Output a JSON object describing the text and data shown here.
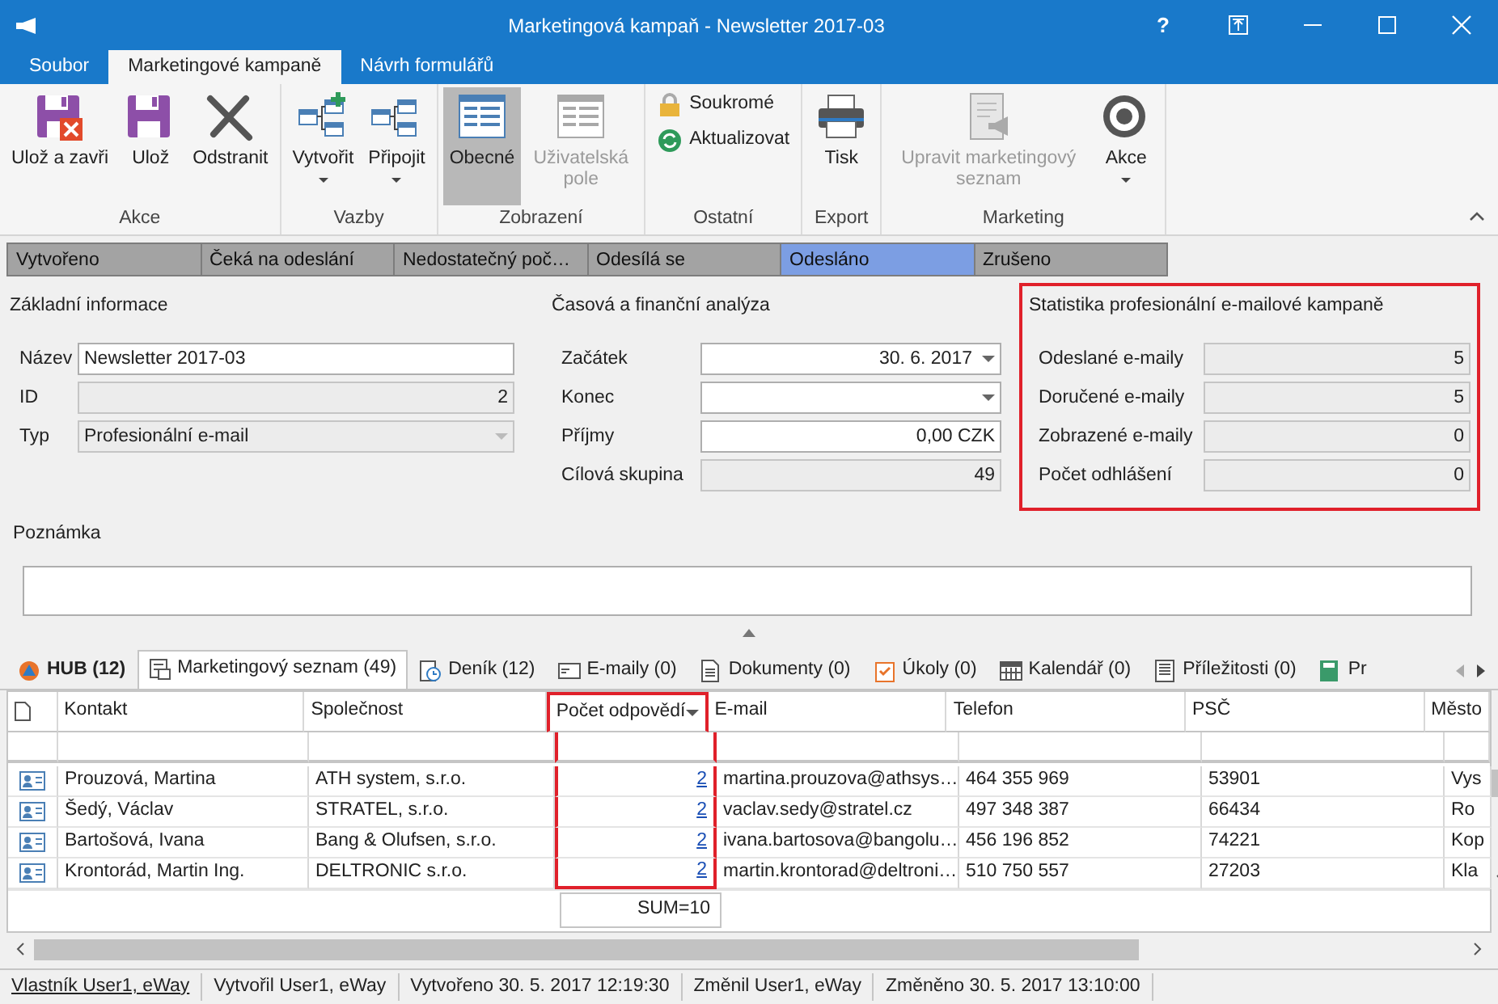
{
  "window": {
    "title": "Marketingová kampaň - Newsletter 2017-03",
    "help": "?"
  },
  "ribbon_tabs": [
    {
      "label": "Soubor",
      "selected": false
    },
    {
      "label": "Marketingové kampaně",
      "selected": true
    },
    {
      "label": "Návrh formulářů",
      "selected": false
    }
  ],
  "ribbon_groups": [
    {
      "label": "Akce",
      "kind": "large",
      "buttons": [
        {
          "label": "Ulož a zavři",
          "disabled": false,
          "selected": false,
          "dropdown": false
        },
        {
          "label": "Ulož",
          "disabled": false,
          "selected": false,
          "dropdown": false
        },
        {
          "label": "Odstranit",
          "disabled": false,
          "selected": false,
          "dropdown": false
        }
      ]
    },
    {
      "label": "Vazby",
      "kind": "large",
      "buttons": [
        {
          "label": "Vytvořit",
          "disabled": false,
          "selected": false,
          "dropdown": true
        },
        {
          "label": "Připojit",
          "disabled": false,
          "selected": false,
          "dropdown": true
        }
      ]
    },
    {
      "label": "Zobrazení",
      "kind": "large",
      "buttons": [
        {
          "label": "Obecné",
          "disabled": false,
          "selected": true,
          "dropdown": false
        },
        {
          "label": "Uživatelská pole",
          "disabled": true,
          "selected": false,
          "dropdown": false
        }
      ]
    },
    {
      "label": "Ostatní",
      "kind": "small",
      "buttons": [
        {
          "label": "Soukromé"
        },
        {
          "label": "Aktualizovat"
        }
      ]
    },
    {
      "label": "Export",
      "kind": "large",
      "buttons": [
        {
          "label": "Tisk",
          "disabled": false,
          "selected": false,
          "dropdown": false
        }
      ]
    },
    {
      "label": "Marketing",
      "kind": "large",
      "buttons": [
        {
          "label": "Upravit marketingový seznam",
          "disabled": true,
          "selected": false,
          "dropdown": false
        },
        {
          "label": "Akce",
          "disabled": false,
          "selected": false,
          "dropdown": true
        }
      ]
    }
  ],
  "stages": [
    {
      "label": "Vytvořeno",
      "selected": false
    },
    {
      "label": "Čeká na odeslání",
      "selected": false
    },
    {
      "label": "Nedostatečný poč…",
      "selected": false
    },
    {
      "label": "Odesílá se",
      "selected": false
    },
    {
      "label": "Odesláno",
      "selected": true
    },
    {
      "label": "Zrušeno",
      "selected": false
    }
  ],
  "sections": [
    {
      "title": "Základní informace",
      "highlighted": false,
      "fields": [
        {
          "label": "Název",
          "value": "Newsletter 2017-03",
          "kind": "text"
        },
        {
          "label": "ID",
          "value": "2",
          "kind": "readonly"
        },
        {
          "label": "Typ",
          "value": "Profesionální e-mail",
          "kind": "readonly-combo"
        }
      ]
    },
    {
      "title": "Časová a finanční analýza",
      "highlighted": false,
      "fields": [
        {
          "label": "Začátek",
          "value": "30. 6. 2017",
          "kind": "combo"
        },
        {
          "label": "Konec",
          "kind": "combo"
        },
        {
          "label": "Příjmy",
          "value": "0,00 CZK",
          "kind": "text"
        },
        {
          "label": "Cílová skupina",
          "value": "49",
          "kind": "readonly"
        }
      ]
    },
    {
      "title": "Statistika profesionální e-mailové kampaně",
      "highlighted": true,
      "fields": [
        {
          "label": "Odeslané e-maily",
          "value": "5",
          "kind": "readonly"
        },
        {
          "label": "Doručené e-maily",
          "value": "5",
          "kind": "readonly"
        },
        {
          "label": "Zobrazené e-maily",
          "value": "0",
          "kind": "readonly"
        },
        {
          "label": "Počet odhlášení",
          "value": "0",
          "kind": "readonly"
        }
      ]
    }
  ],
  "note": {
    "label": "Poznámka"
  },
  "bottom_tabs": [
    {
      "label": "HUB (12)",
      "selected": false,
      "kind": "hub"
    },
    {
      "label": "Marketingový seznam (49)",
      "selected": true,
      "kind": "list"
    },
    {
      "label": "Deník (12)",
      "selected": false,
      "kind": "journal"
    },
    {
      "label": "E-maily (0)",
      "selected": false,
      "kind": "email"
    },
    {
      "label": "Dokumenty (0)",
      "selected": false,
      "kind": "document"
    },
    {
      "label": "Úkoly (0)",
      "selected": false,
      "kind": "task"
    },
    {
      "label": "Kalendář (0)",
      "selected": false,
      "kind": "calendar"
    },
    {
      "label": "Příležitosti (0)",
      "selected": false,
      "kind": "opportunity"
    },
    {
      "label": "Pr",
      "selected": false,
      "kind": "book"
    }
  ],
  "grid": {
    "columns": [
      {
        "label": "Kontakt",
        "kind": "text",
        "highlighted": false,
        "filter_button": false
      },
      {
        "label": "Společnost",
        "kind": "text",
        "highlighted": false,
        "filter_button": false
      },
      {
        "label": "Počet odpovědí",
        "kind": "link",
        "highlighted": true,
        "filter_button": true
      },
      {
        "label": "E-mail",
        "kind": "text",
        "highlighted": false,
        "filter_button": false
      },
      {
        "label": "Telefon",
        "kind": "text",
        "highlighted": false,
        "filter_button": false
      },
      {
        "label": "PSČ",
        "kind": "text",
        "highlighted": false,
        "filter_button": false
      },
      {
        "label": "Město",
        "kind": "text",
        "highlighted": false,
        "filter_button": false
      }
    ],
    "rows": [
      [
        "Prouzová, Martina",
        "ATH system, s.r.o.",
        "2",
        "martina.prouzova@athsys…",
        "464 355 969",
        "53901",
        "Vys"
      ],
      [
        "Šedý, Václav",
        "STRATEL, s.r.o.",
        "2",
        "vaclav.sedy@stratel.cz",
        "497 348 387",
        "66434",
        "Ro"
      ],
      [
        "Bartošová, Ivana",
        "Bang & Olufsen, s.r.o.",
        "2",
        "ivana.bartosova@bangolu…",
        "456 196 852",
        "74221",
        "Kop"
      ],
      [
        "Krontorád, Martin Ing.",
        "DELTRONIC s.r.o.",
        "2",
        "martin.krontorad@deltroni…",
        "510 750 557",
        "27203",
        "Kla"
      ]
    ],
    "sum": "SUM=10"
  },
  "status_bar": [
    {
      "label": "Vlastník User1, eWay",
      "kind": "link"
    },
    {
      "label": "Vytvořil User1, eWay",
      "kind": "text"
    },
    {
      "label": "Vytvořeno 30. 5. 2017 12:19:30",
      "kind": "text"
    },
    {
      "label": "Změnil User1, eWay",
      "kind": "text"
    },
    {
      "label": "Změněno 30. 5. 2017 13:10:00",
      "kind": "text"
    }
  ]
}
